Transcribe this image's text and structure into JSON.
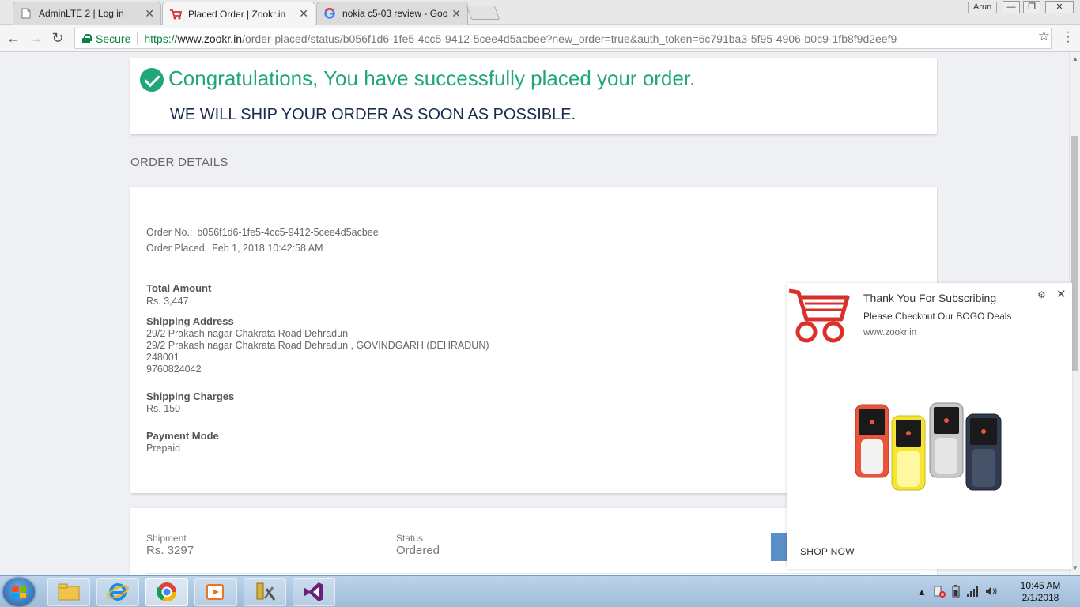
{
  "browser": {
    "tabs": [
      {
        "title": "AdminLTE 2 | Log in",
        "icon": "document-icon",
        "active": false
      },
      {
        "title": "Placed Order | Zookr.in",
        "icon": "cart-icon",
        "active": true
      },
      {
        "title": "nokia c5-03 review - Goo",
        "icon": "google-icon",
        "active": false
      }
    ],
    "close_glyph": "✕",
    "user": "Arun",
    "secure_label": "Secure",
    "url_scheme": "https://",
    "url_host": "www.zookr.in",
    "url_path": "/order-placed/status/b056f1d6-1fe5-4cc5-9412-5cee4d5acbee?new_order=true&auth_token=6c791ba3-5f95-4906-b0c9-1fb8f9d2eef9"
  },
  "success": {
    "headline": "Congratulations, You have successfully placed your order.",
    "subline": "WE WILL SHIP YOUR ORDER AS SOON AS POSSIBLE."
  },
  "order_details": {
    "section_title": "ORDER DETAILS",
    "order_no_label": "Order No.:",
    "order_no": "b056f1d6-1fe5-4cc5-9412-5cee4d5acbee",
    "order_placed_label": "Order Placed:",
    "order_placed": "Feb 1, 2018 10:42:58 AM",
    "total_label": "Total Amount",
    "total": "Rs. 3,447",
    "shipping_label": "Shipping Address",
    "address_lines": [
      "29/2 Prakash nagar Chakrata Road Dehradun",
      "29/2 Prakash nagar Chakrata Road Dehradun , GOVINDGARH (DEHRADUN)",
      "248001",
      "9760824042"
    ],
    "charges_label": "Shipping Charges",
    "charges": "Rs. 150",
    "payment_label": "Payment Mode",
    "payment": "Prepaid"
  },
  "shipment": {
    "shipment_label": "Shipment",
    "shipment_value": "Rs. 3297",
    "status_label": "Status",
    "status_value": "Ordered",
    "button_color": "#5b8fc9"
  },
  "notification": {
    "title": "Thank You For Subscribing",
    "body": "Please Checkout Our BOGO Deals",
    "site": "www.zookr.in",
    "cta": "SHOP NOW",
    "icon": "cart-icon",
    "accent": "#d9302c"
  },
  "taskbar": {
    "time": "10:45 AM",
    "date": "2/1/2018",
    "items": [
      "explorer-icon",
      "ie-icon",
      "chrome-icon",
      "media-player-icon",
      "tools-icon",
      "visual-studio-icon"
    ]
  },
  "colors": {
    "brand_green": "#1fa67a",
    "heading_navy": "#1a2b4c"
  }
}
